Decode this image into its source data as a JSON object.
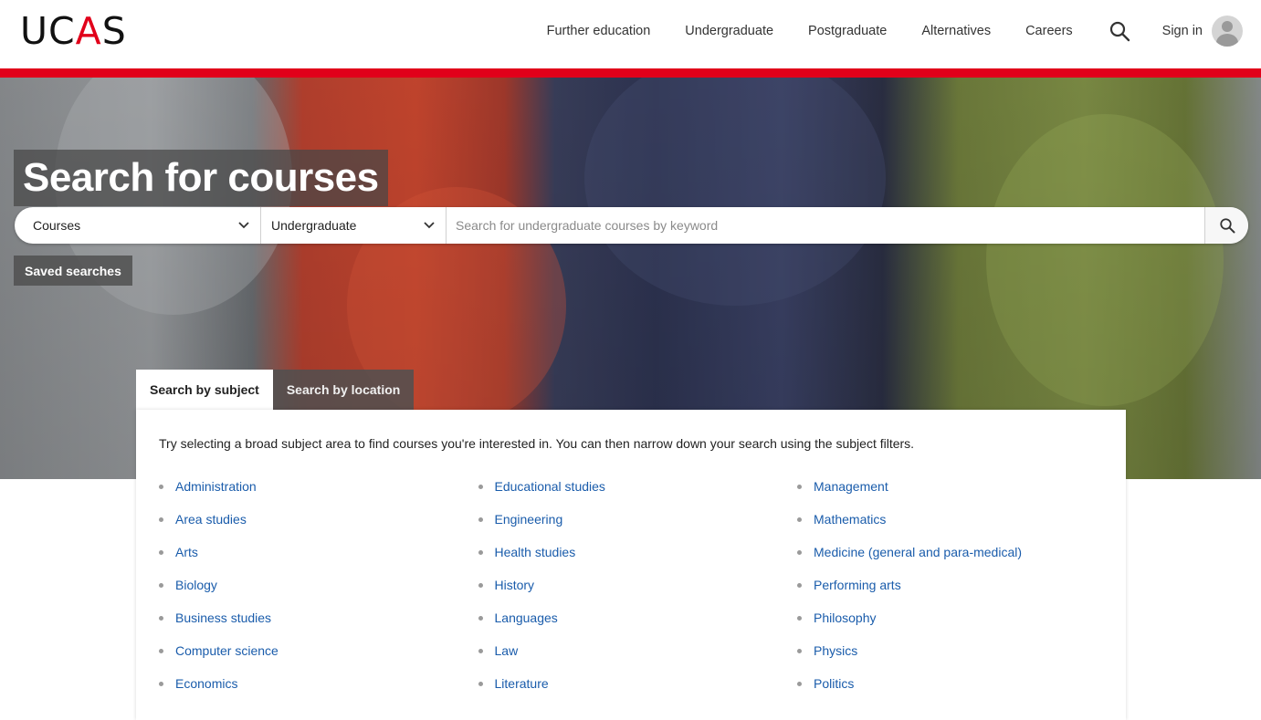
{
  "logo": {
    "text_pre": "UC",
    "text_a": "A",
    "text_post": "S"
  },
  "nav": {
    "items": [
      "Further education",
      "Undergraduate",
      "Postgraduate",
      "Alternatives",
      "Careers"
    ],
    "search_icon": "search-icon",
    "signin_label": "Sign in",
    "avatar_icon": "user-avatar-icon"
  },
  "colors": {
    "brand_red": "#e1001a",
    "link_blue": "#1a5cab"
  },
  "hero": {
    "title": "Search for courses",
    "search": {
      "type_value": "Courses",
      "level_value": "Undergraduate",
      "placeholder": "Search for undergraduate courses by keyword"
    },
    "saved_searches_label": "Saved searches"
  },
  "tabs": {
    "subject": "Search by subject",
    "location": "Search by location"
  },
  "panel": {
    "intro": "Try selecting a broad subject area to find courses you're interested in. You can then narrow down your search using the subject filters.",
    "columns": [
      [
        "Administration",
        "Area studies",
        "Arts",
        "Biology",
        "Business studies",
        "Computer science",
        "Economics"
      ],
      [
        "Educational studies",
        "Engineering",
        "Health studies",
        "History",
        "Languages",
        "Law",
        "Literature"
      ],
      [
        "Management",
        "Mathematics",
        "Medicine (general and para-medical)",
        "Performing arts",
        "Philosophy",
        "Physics",
        "Politics"
      ]
    ]
  }
}
